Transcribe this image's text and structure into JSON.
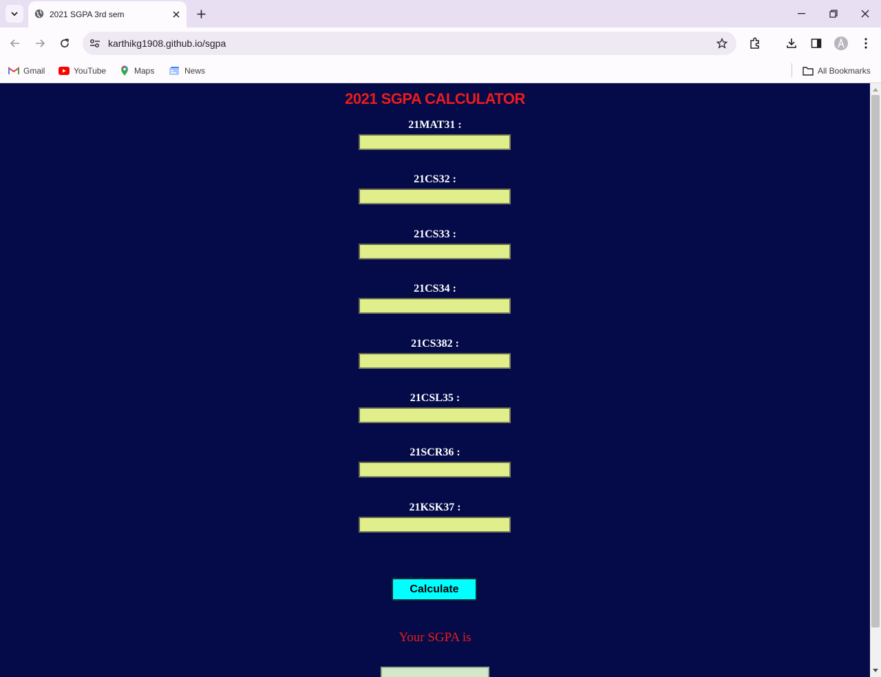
{
  "browser": {
    "tab_title": "2021 SGPA 3rd sem",
    "url": "karthikg1908.github.io/sgpa",
    "bookmarks": [
      {
        "label": "Gmail",
        "icon": "gmail-icon"
      },
      {
        "label": "YouTube",
        "icon": "youtube-icon"
      },
      {
        "label": "Maps",
        "icon": "maps-icon"
      },
      {
        "label": "News",
        "icon": "news-icon"
      }
    ],
    "all_bookmarks_label": "All Bookmarks"
  },
  "page": {
    "title": "2021 SGPA CALCULATOR",
    "subjects": [
      {
        "label": "21MAT31 :",
        "value": ""
      },
      {
        "label": "21CS32 :",
        "value": ""
      },
      {
        "label": "21CS33 :",
        "value": ""
      },
      {
        "label": "21CS34 :",
        "value": ""
      },
      {
        "label": "21CS382 :",
        "value": ""
      },
      {
        "label": "21CSL35 :",
        "value": ""
      },
      {
        "label": "21SCR36 :",
        "value": ""
      },
      {
        "label": "21KSK37 :",
        "value": ""
      }
    ],
    "calculate_label": "Calculate",
    "result_label": "Your SGPA is",
    "result_value": ""
  },
  "colors": {
    "page_background": "#040b48",
    "title": "#ef1b1b",
    "input_background": "#e1ee8c",
    "button_background": "#00ffff",
    "result_text": "#ef1b1b"
  }
}
